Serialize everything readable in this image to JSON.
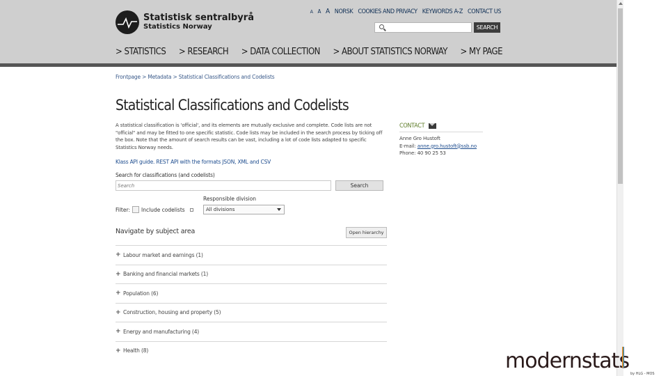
{
  "header": {
    "logo_main": "Statistisk sentralbyrå",
    "logo_sub": "Statistics Norway",
    "text_size": [
      "A",
      "A",
      "A"
    ],
    "top_links": [
      "NORSK",
      "COOKIES AND PRIVACY",
      "KEYWORDS A-Z",
      "CONTACT US"
    ],
    "search_button": "SEARCH",
    "nav": [
      "> STATISTICS",
      "> RESEARCH",
      "> DATA COLLECTION",
      "> ABOUT STATISTICS NORWAY",
      "> MY PAGE"
    ]
  },
  "breadcrumb": "Frontpage > Metadata > Statistical Classifications and Codelists",
  "title": "Statistical Classifications and Codelists",
  "intro": "A statistical classification is 'official', and its elements are mutually exclusive and complete. Code lists are not \"official\" and may be fitted to one specific statistic. Code lists may be included in the search process by ticking off the box. Note that the amount of search results can be vast, including a lot of code lists adapted to specific Statistics Norway needs.",
  "api_link": "Klass API guide. REST API with the formats JSON, XML and CSV",
  "class_search": {
    "label": "Search for classifications (and codelists)",
    "placeholder": "Search",
    "button": "Search"
  },
  "filter": {
    "label": "Filter:",
    "checkbox_label": "Include codelists",
    "division_label": "Responsible division",
    "division_value": "All divisions"
  },
  "navigate": {
    "heading": "Navigate by subject area",
    "hierarchy_button": "Open hierarchy",
    "items": [
      "Labour market and earnings (1)",
      "Banking and financial markets (1)",
      "Population (6)",
      "Construction, housing and property (5)",
      "Energy and manufacturing (4)",
      "Health (8)"
    ]
  },
  "contact": {
    "title": "CONTACT",
    "name": "Anne Gro Hustoft",
    "email_label": "E-mail:",
    "email": "anne.gro.hustoft@ssb.no",
    "phone": "Phone: 40 90 25 53"
  },
  "colors": {
    "accent_green": "#5f7d2a",
    "link_blue": "#1d4c8e",
    "header_gray": "#cfcfcf"
  },
  "watermark": "modernstats"
}
